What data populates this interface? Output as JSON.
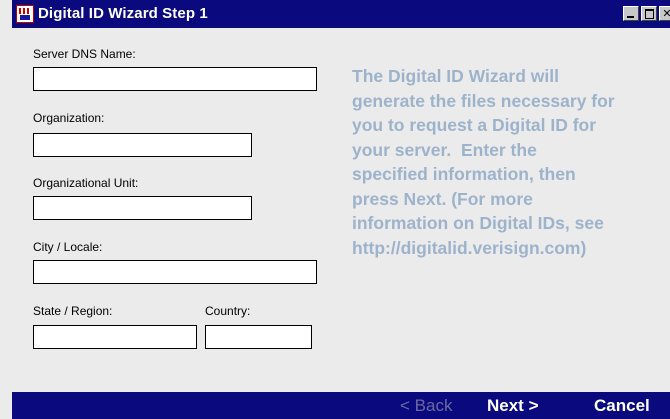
{
  "window": {
    "title": "Digital ID Wizard Step 1",
    "icon": "certificate-app-icon"
  },
  "form": {
    "server_dns_name": {
      "label": "Server DNS Name:",
      "value": ""
    },
    "organization": {
      "label": "Organization:",
      "value": ""
    },
    "organizational_unit": {
      "label": "Organizational Unit:",
      "value": ""
    },
    "city_locale": {
      "label": "City / Locale:",
      "value": ""
    },
    "state_region": {
      "label": "State / Region:",
      "value": ""
    },
    "country": {
      "label": "Country:",
      "value": ""
    }
  },
  "info": {
    "lines": [
      "The Digital ID Wizard will",
      "generate the files necessary for",
      "you to request a Digital ID for",
      "your server.  Enter the",
      "specified information, then",
      "press Next. (For more",
      "information on Digital IDs, see",
      "http://digitalid.verisign.com)"
    ]
  },
  "nav": {
    "back_label": "< Back",
    "back_enabled": false,
    "next_label": "Next >",
    "cancel_label": "Cancel"
  },
  "colors": {
    "titlebar": "#0a0a7e",
    "background": "#ebebeb",
    "info_text": "#9db3cb"
  }
}
